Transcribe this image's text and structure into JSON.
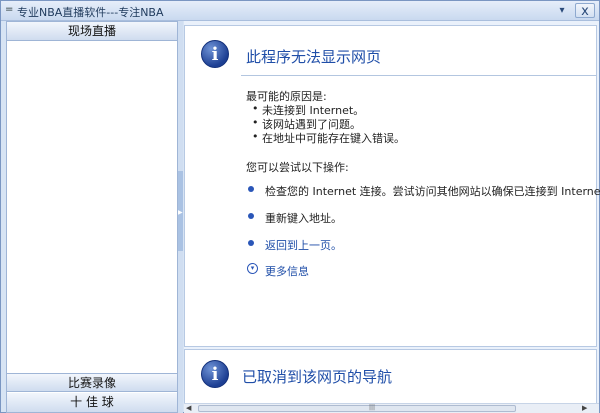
{
  "window": {
    "app_icon": "=",
    "title": "专业NBA直播软件---专注NBA",
    "minimize_symbol": "▾",
    "close_symbol": "x"
  },
  "sidebar": {
    "top_header": "现场直播",
    "middle_header": "比赛录像",
    "bottom_header": "十 佳 球"
  },
  "error_page": {
    "heading": "此程序无法显示网页",
    "causes_label": "最可能的原因是:",
    "causes": [
      "未连接到 Internet。",
      "该网站遇到了问题。",
      "在地址中可能存在键入错误。"
    ],
    "actions_label": "您可以尝试以下操作:",
    "actions": [
      "检查您的 Internet 连接。尝试访问其他网站以确保已连接到 Internet。",
      "重新键入地址。",
      "返回到上一页。"
    ],
    "more_info": "更多信息"
  },
  "navigation_cancelled": {
    "heading": "已取消到该网页的导航"
  },
  "icons": {
    "info": "i",
    "chevron_down": "▾",
    "scroll_left": "◀",
    "scroll_right": "▶",
    "scroll_grip": "|||"
  }
}
